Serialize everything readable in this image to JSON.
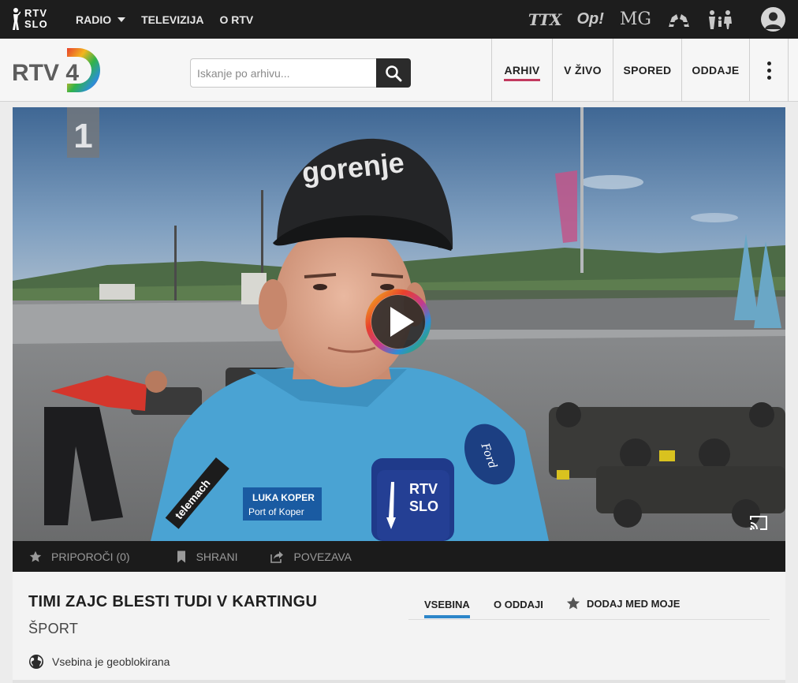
{
  "topbar": {
    "logo_text_line1": "RTV",
    "logo_text_line2": "SLO",
    "nav": [
      {
        "label": "RADIO"
      },
      {
        "label": "TELEVIZIJA"
      },
      {
        "label": "O RTV"
      }
    ],
    "brands": [
      "TTX",
      "Op!",
      "MG"
    ]
  },
  "header": {
    "logo_text": "RTV 4",
    "search": {
      "placeholder": "Iskanje po arhivu...",
      "value": ""
    },
    "tabs": [
      {
        "label": "ARHIV",
        "active": true
      },
      {
        "label": "V ŽIVO"
      },
      {
        "label": "SPORED"
      },
      {
        "label": "ODDAJE"
      }
    ]
  },
  "player": {
    "channel_badge": "1",
    "cap_brand": "gorenje",
    "shirt_text1": "LUKA KOPER",
    "shirt_text2": "Port of Koper",
    "shirt_text3": "telemach",
    "shirt_text4": "Ford",
    "mic_line1": "RTV",
    "mic_line2": "SLO"
  },
  "actions": {
    "recommend_label": "PRIPOROČI (0)",
    "save_label": "SHRANI",
    "link_label": "POVEZAVA"
  },
  "info": {
    "title": "TIMI ZAJC BLESTI TUDI V KARTINGU",
    "subtitle": "ŠPORT",
    "geo_text": "Vsebina je geoblokirana",
    "tabs": [
      {
        "label": "VSEBINA",
        "active": true
      },
      {
        "label": "O ODDAJI"
      },
      {
        "label": "DODAJ MED MOJE"
      }
    ]
  },
  "colors": {
    "accent_pink": "#c23a5f",
    "accent_blue": "#2c86c9",
    "topbar_bg": "#1d1d1d"
  }
}
